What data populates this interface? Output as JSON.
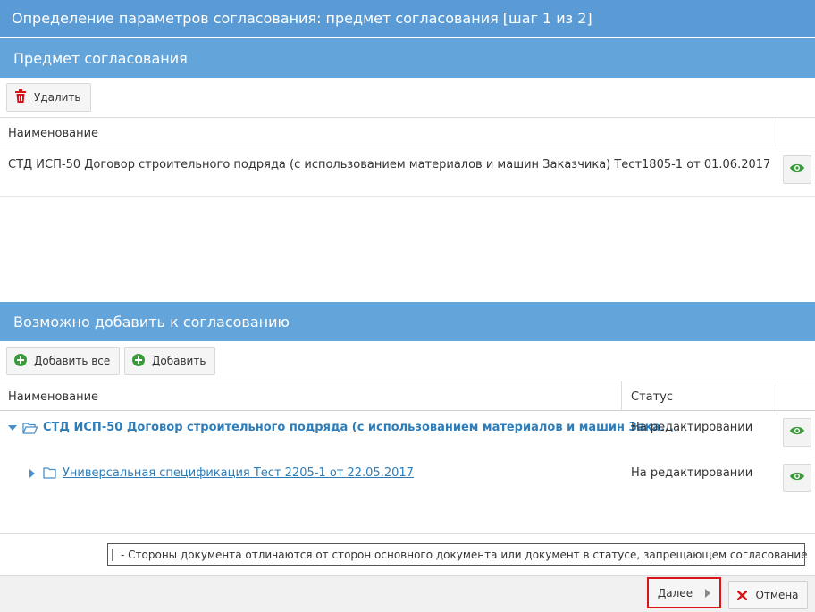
{
  "window": {
    "title": "Определение параметров согласования: предмет согласования [шаг 1 из 2]"
  },
  "subject_section": {
    "title": "Предмет согласования",
    "delete_label": "Удалить",
    "col_name": "Наименование",
    "rows": [
      {
        "name": "СТД ИСП-50 Договор строительного подряда (с использованием материалов и машин Заказчика) Тест1805-1 от 01.06.2017"
      }
    ]
  },
  "available_section": {
    "title": "Возможно добавить к согласованию",
    "add_all_label": "Добавить все",
    "add_label": "Добавить",
    "col_name": "Наименование",
    "col_status": "Статус",
    "rows": [
      {
        "name": "СТД ИСП-50 Договор строительного подряда (с использованием материалов и машин Зака...",
        "status": "На редактировании",
        "expanded": true
      },
      {
        "name": "Универсальная спецификация Тест 2205-1 от 22.05.2017",
        "status": "На редактировании",
        "expanded": false
      }
    ]
  },
  "legend": {
    "text": "- Стороны документа отличаются от сторон основного документа или документ в статусе, запрещающем согласование"
  },
  "footer": {
    "next_label": "Далее",
    "cancel_label": "Отмена"
  },
  "colors": {
    "title_bar": "#5b9bd5",
    "section_header": "#63a5db",
    "link": "#2e7db8",
    "delete_icon": "#d9141b",
    "add_icon": "#3a9a3a",
    "eye_icon": "#3a9a3a",
    "cancel_icon": "#d9141b"
  }
}
